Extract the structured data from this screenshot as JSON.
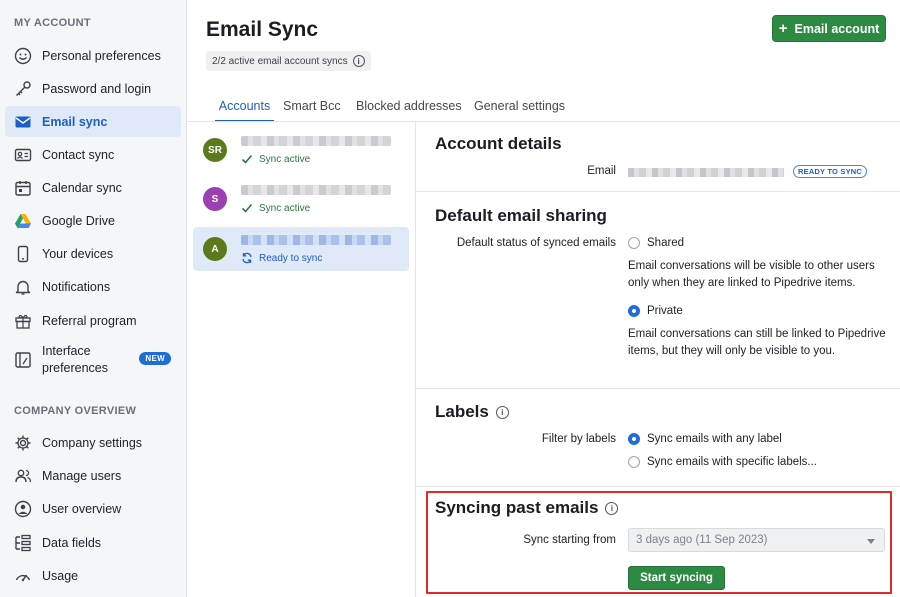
{
  "sidebar": {
    "account_heading": "MY ACCOUNT",
    "company_heading": "COMPANY OVERVIEW",
    "account_items": [
      {
        "label": "Personal preferences",
        "icon": "smiley-face-icon"
      },
      {
        "label": "Password and login",
        "icon": "key-icon"
      },
      {
        "label": "Email sync",
        "icon": "envelope-icon",
        "active": true
      },
      {
        "label": "Contact sync",
        "icon": "contact-card-icon"
      },
      {
        "label": "Calendar sync",
        "icon": "calendar-icon"
      },
      {
        "label": "Google Drive",
        "icon": "google-drive-icon"
      },
      {
        "label": "Your devices",
        "icon": "phone-icon"
      },
      {
        "label": "Notifications",
        "icon": "bell-icon"
      },
      {
        "label": "Referral program",
        "icon": "gift-icon"
      },
      {
        "label": "Interface preferences",
        "icon": "interface-icon",
        "badge": "NEW"
      }
    ],
    "company_items": [
      {
        "label": "Company settings",
        "icon": "gear-icon"
      },
      {
        "label": "Manage users",
        "icon": "users-icon"
      },
      {
        "label": "User overview",
        "icon": "user-circle-icon"
      },
      {
        "label": "Data fields",
        "icon": "data-fields-icon"
      },
      {
        "label": "Usage",
        "icon": "gauge-icon"
      }
    ]
  },
  "header": {
    "title": "Email Sync",
    "sync_count": "2/2 active email account syncs",
    "add_button": "Email account"
  },
  "tabs": [
    {
      "label": "Accounts",
      "active": true
    },
    {
      "label": "Smart Bcc"
    },
    {
      "label": "Blocked addresses"
    },
    {
      "label": "General settings"
    }
  ],
  "accounts": [
    {
      "initials": "SR",
      "color": "#5b7a1c",
      "status": "Sync active"
    },
    {
      "initials": "S",
      "color": "#9c3fb0",
      "status": "Sync active"
    },
    {
      "initials": "A",
      "color": "#5b7a1c",
      "status": "Ready to sync",
      "selected": true
    }
  ],
  "details": {
    "account_heading": "Account details",
    "email_label": "Email",
    "ready_badge": "READY TO SYNC",
    "sharing_heading": "Default email sharing",
    "sharing_label": "Default status of synced emails",
    "shared_option": "Shared",
    "shared_desc": "Email conversations will be visible to other users only when they are linked to Pipedrive items.",
    "private_option": "Private",
    "private_desc": "Email conversations can still be linked to Pipedrive items, but they will only be visible to you.",
    "labels_heading": "Labels",
    "filter_label": "Filter by labels",
    "any_label_option": "Sync emails with any label",
    "specific_label_option": "Sync emails with specific labels...",
    "past_heading": "Syncing past emails",
    "sync_from_label": "Sync starting from",
    "sync_from_value": "3 days ago (11 Sep 2023)",
    "start_button": "Start syncing"
  },
  "colors": {
    "accent_blue": "#1d5ec9",
    "primary_green": "#2d8a42",
    "highlight_red": "#e02a2a"
  }
}
